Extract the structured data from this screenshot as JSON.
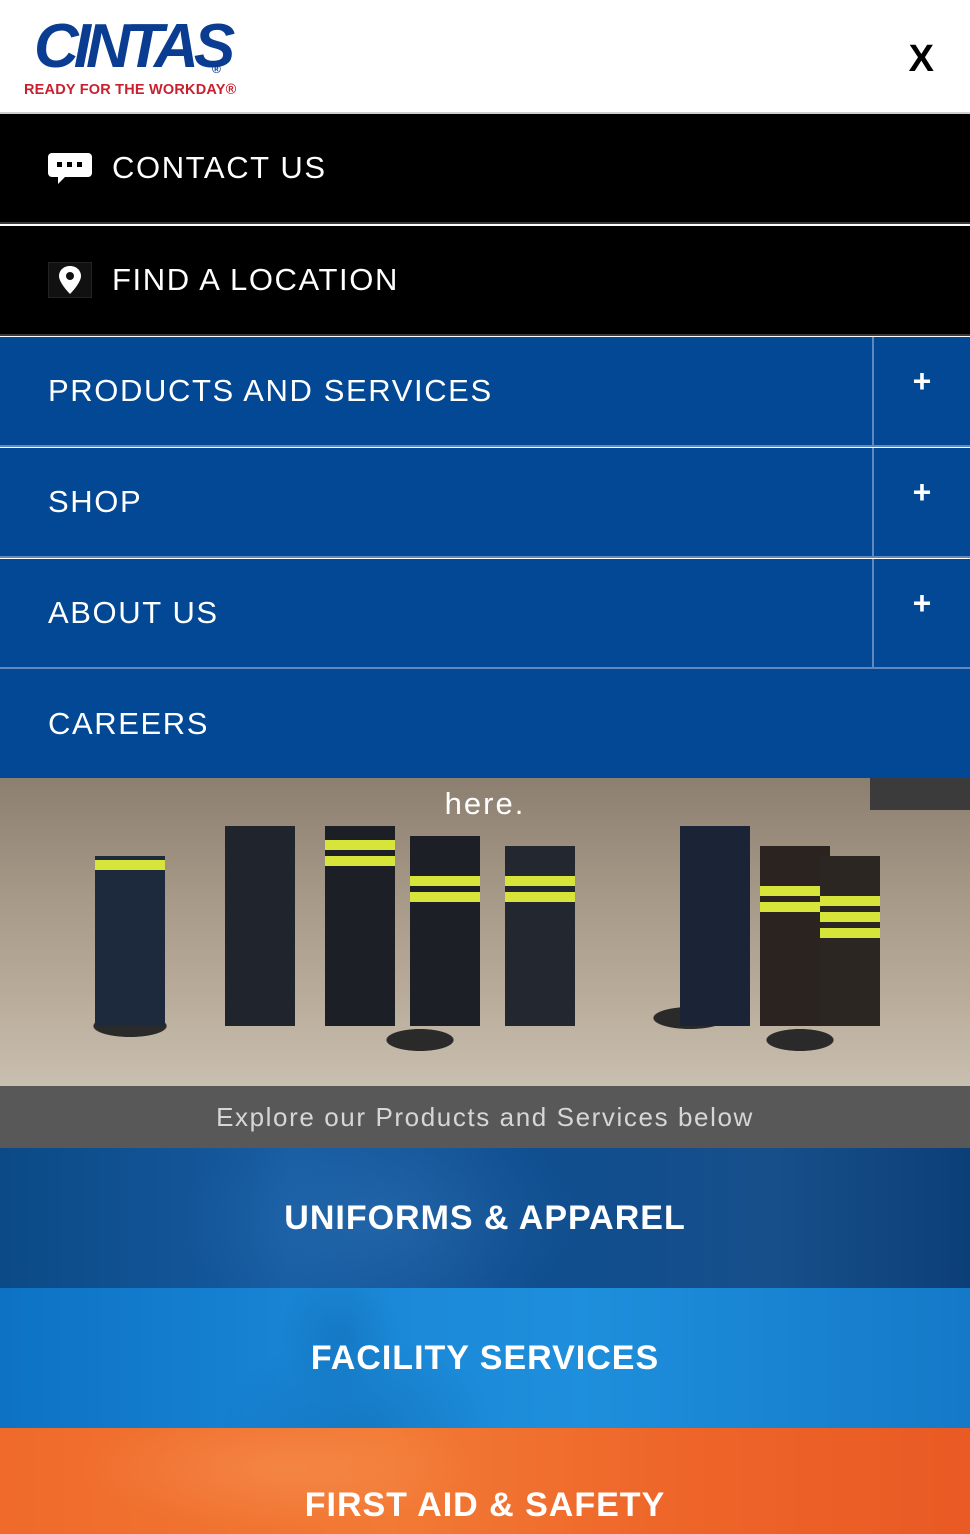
{
  "header": {
    "logo_word": "CINTAS",
    "logo_reg": "®",
    "logo_tagline": "READY FOR THE WORKDAY®",
    "close_label": "X"
  },
  "nav": {
    "contact_label": "CONTACT US",
    "location_label": "FIND A LOCATION",
    "products_label": "PRODUCTS AND SERVICES",
    "shop_label": "SHOP",
    "about_label": "ABOUT US",
    "careers_label": "CAREERS",
    "expand_symbol": "+"
  },
  "hero": {
    "partial_text": "here."
  },
  "explore_text": "Explore our Products and Services below",
  "categories": [
    {
      "label": "UNIFORMS & APPAREL"
    },
    {
      "label": "FACILITY SERVICES"
    },
    {
      "label": "FIRST AID & SAFETY"
    }
  ],
  "colors": {
    "brand_blue": "#024895",
    "brand_red": "#c8202f",
    "nav_black": "#000000",
    "facility_blue": "#1a87d6",
    "firstaid_orange": "#f27a35"
  }
}
